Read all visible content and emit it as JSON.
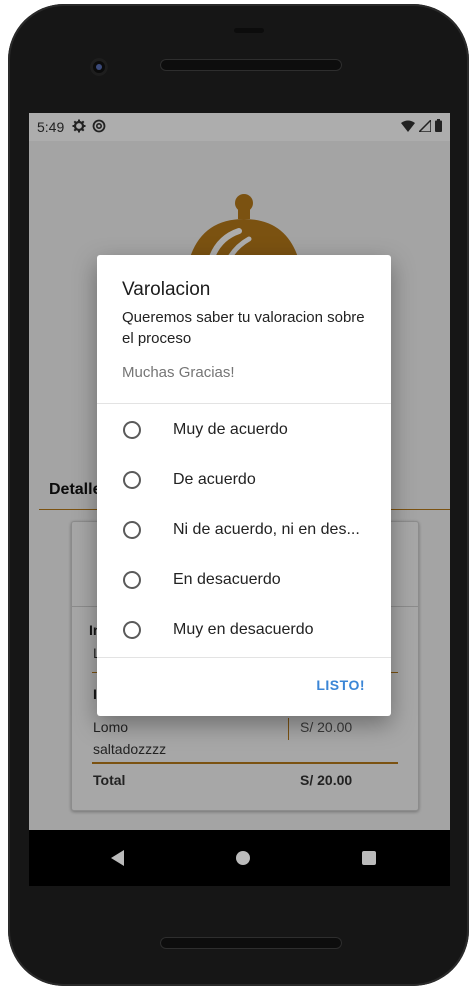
{
  "status_bar": {
    "time": "5:49"
  },
  "icons": {
    "settings": "gear-icon",
    "sync": "sync-icon",
    "wifi": "wifi-icon",
    "signal": "signal-icon",
    "battery": "battery-icon"
  },
  "colors": {
    "accent": "#b5791a",
    "button": "#3b86d6"
  },
  "background": {
    "section_title": "Detalle",
    "rows": [
      {
        "name_partial": "In",
        "name_partial_2": "L"
      },
      {
        "name_partial": "I"
      },
      {
        "name": "Lomo\nsaltadozzzz",
        "price": "S/ 20.00"
      }
    ],
    "total_label": "Total",
    "total_value": "S/ 20.00"
  },
  "dialog": {
    "title": "Varolacion",
    "message": "Queremos saber tu valoracion sobre el proceso",
    "thanks": "Muchas Gracias!",
    "options": [
      {
        "label": "Muy de acuerdo"
      },
      {
        "label": "De acuerdo"
      },
      {
        "label": "Ni de acuerdo, ni en des..."
      },
      {
        "label": "En desacuerdo"
      },
      {
        "label": "Muy en desacuerdo"
      }
    ],
    "confirm_label": "LISTO!"
  }
}
